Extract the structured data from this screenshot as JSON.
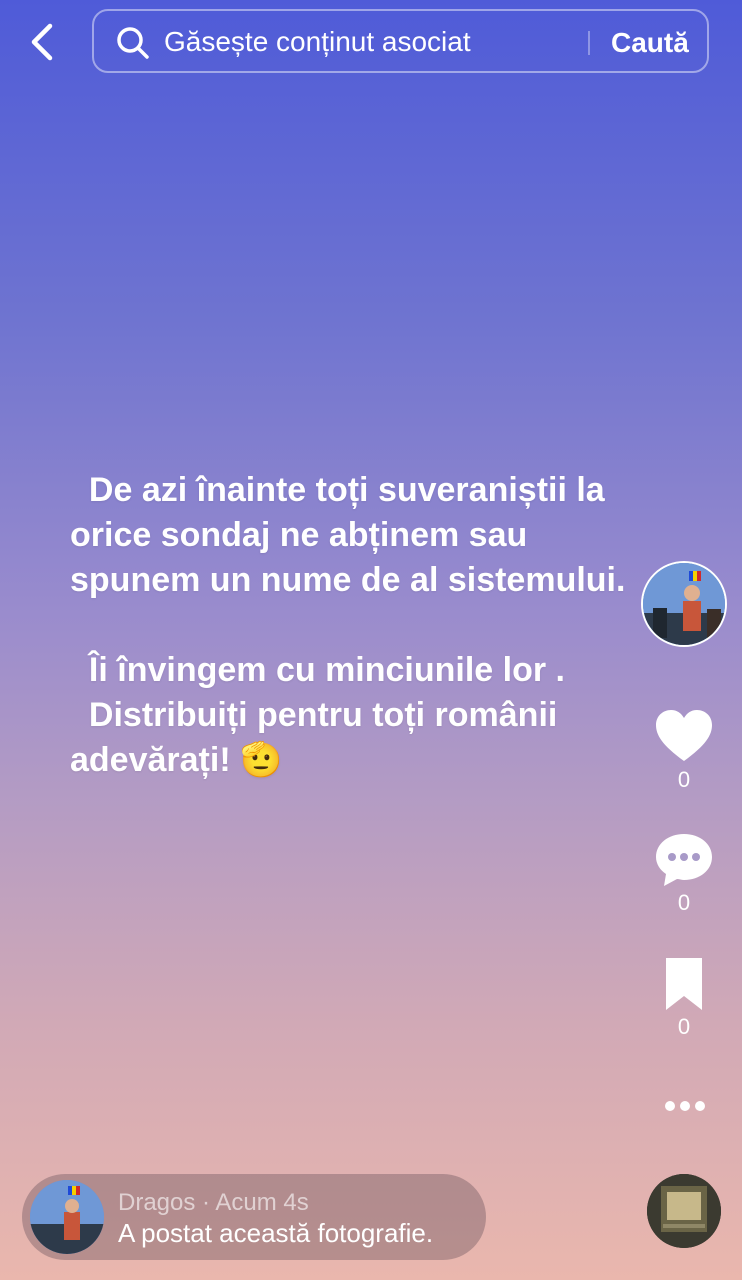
{
  "search": {
    "placeholder": "Găsește conținut asociat",
    "button_label": "Caută"
  },
  "post": {
    "text": "  De azi înainte toți suveraniștii la orice sondaj ne abținem sau spunem un nume de al sistemului.\n\n  Îi învingem cu minciunile lor .\n  Distribuiți pentru toți românii adevărați! 🫡"
  },
  "actions": {
    "likes": "0",
    "comments": "0",
    "saves": "0"
  },
  "author": {
    "name": "Dragos",
    "separator": " · ",
    "time": "Acum 4s",
    "activity": "A postat această fotografie."
  },
  "colors": {
    "gradient_top": "#4f5bd8",
    "gradient_bottom": "#eab7ad"
  }
}
